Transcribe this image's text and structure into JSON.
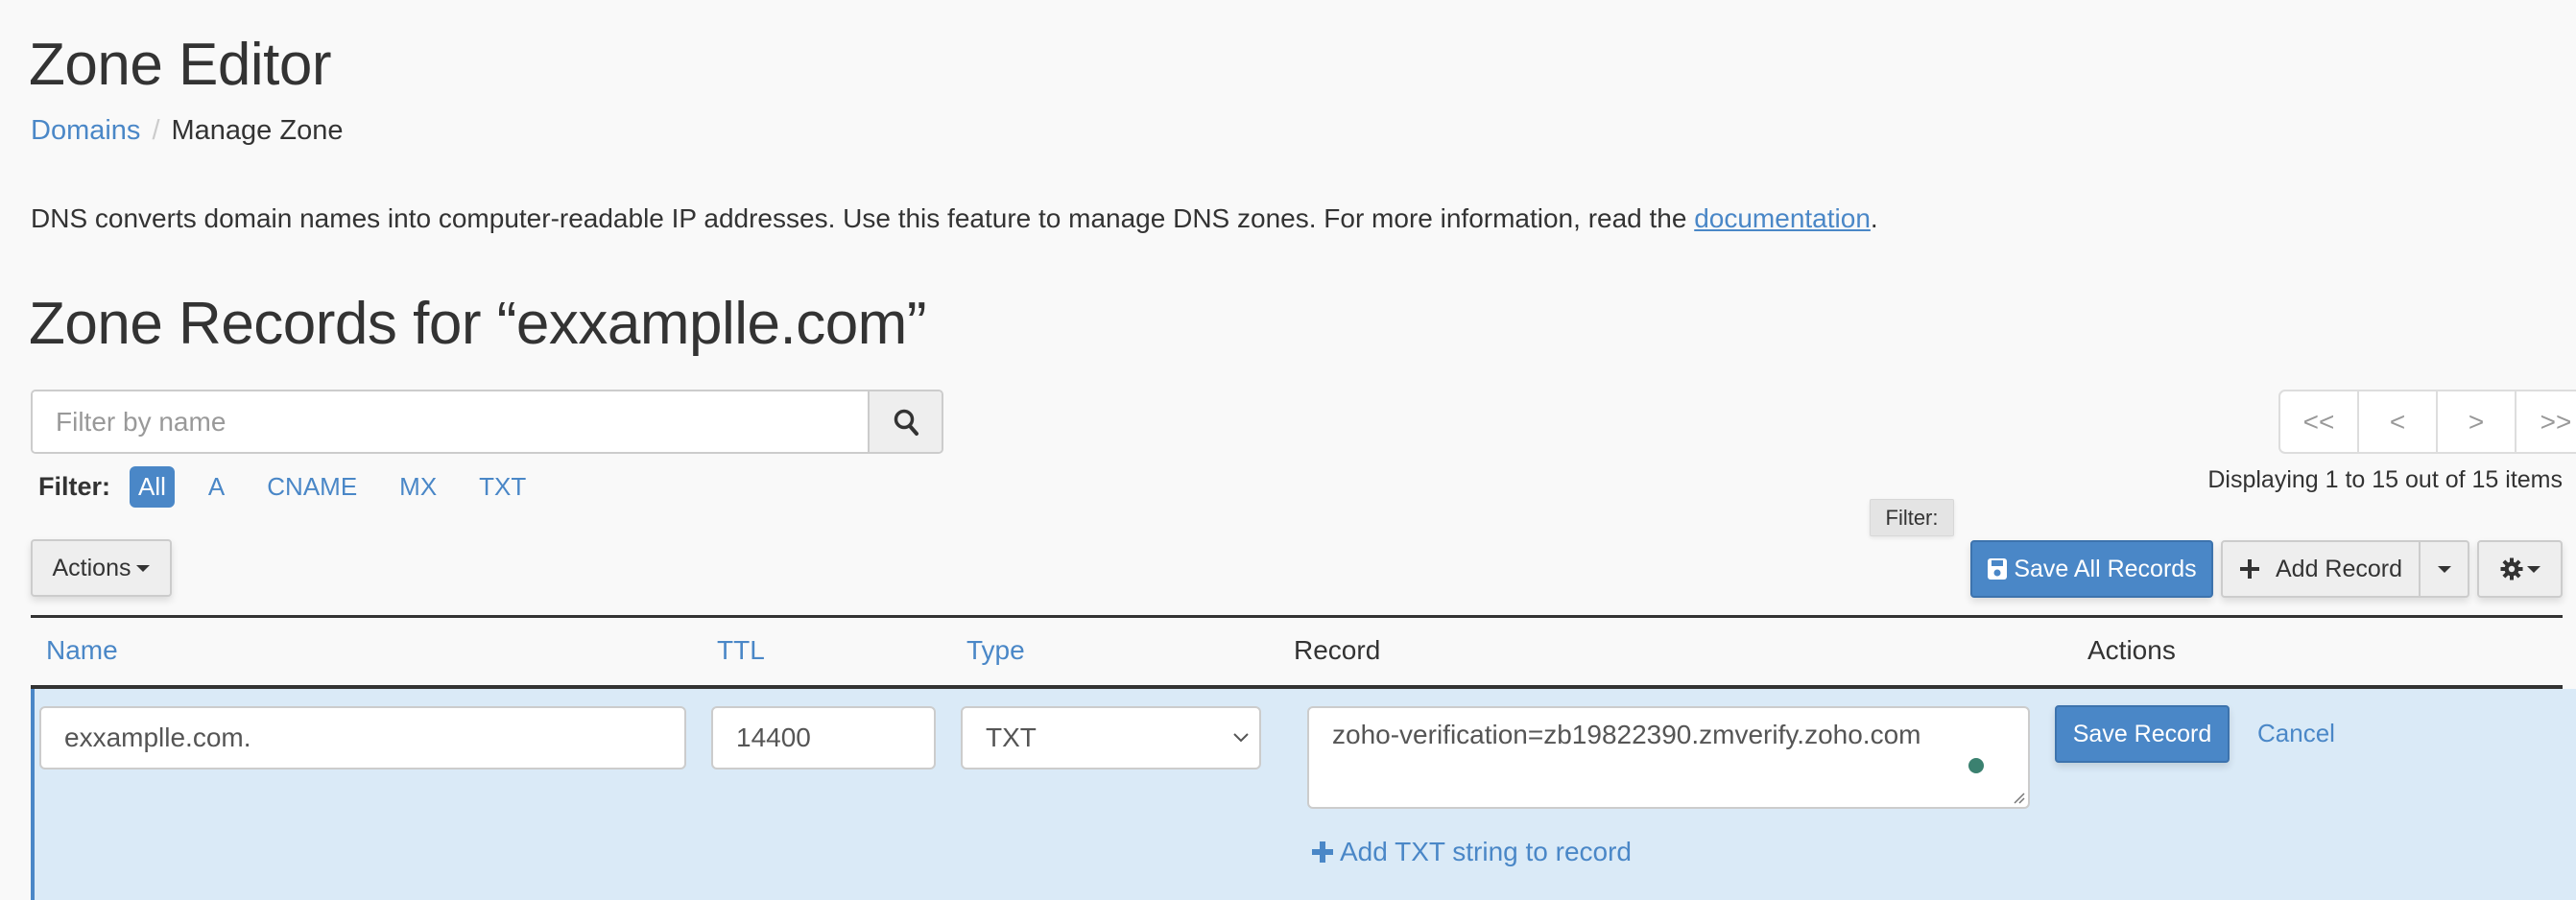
{
  "header": {
    "title": "Zone Editor",
    "breadcrumb": [
      {
        "label": "Domains"
      },
      {
        "label": "Manage Zone"
      }
    ],
    "breadcrumb_separator": "/"
  },
  "description": {
    "text": "DNS converts domain names into computer-readable IP addresses. Use this feature to manage DNS zones. For more information, read the ",
    "link_label": "documentation",
    "suffix": "."
  },
  "zone": {
    "title": "Zone Records for “exxamplle.com”"
  },
  "search": {
    "placeholder": "Filter by name",
    "value": "",
    "icon": "search-icon"
  },
  "filter": {
    "label": "Filter:",
    "options": [
      {
        "label": "All",
        "active": true
      },
      {
        "label": "A",
        "active": false
      },
      {
        "label": "CNAME",
        "active": false
      },
      {
        "label": "MX",
        "active": false
      },
      {
        "label": "TXT",
        "active": false
      }
    ]
  },
  "pagination": {
    "first": "<<",
    "prev": "<",
    "next": ">",
    "last": ">>",
    "status": "Displaying 1 to 15 out of 15 items"
  },
  "tooltip": {
    "text": "Filter:"
  },
  "toolbar": {
    "actions_label": "Actions",
    "save_all_label": "Save All Records",
    "save_all_icon": "floppy-disk-icon",
    "add_record_label": "Add Record",
    "add_record_icon": "plus-icon",
    "settings_icon": "gear-icon"
  },
  "table": {
    "columns": [
      {
        "label": "Name",
        "sortable": true
      },
      {
        "label": "TTL",
        "sortable": true
      },
      {
        "label": "Type",
        "sortable": true
      },
      {
        "label": "Record",
        "sortable": false
      },
      {
        "label": "Actions",
        "sortable": false
      }
    ],
    "edit_row": {
      "name": "exxamplle.com.",
      "ttl": "14400",
      "type": "TXT",
      "record": "zoho-verification=zb19822390.zmverify.zoho.com",
      "save_label": "Save Record",
      "cancel_label": "Cancel",
      "add_txt_label": "Add TXT string to record"
    }
  },
  "colors": {
    "accent": "#4a87c7",
    "edit_row_bg": "#daeaf7",
    "status_dot": "#3b8170"
  }
}
